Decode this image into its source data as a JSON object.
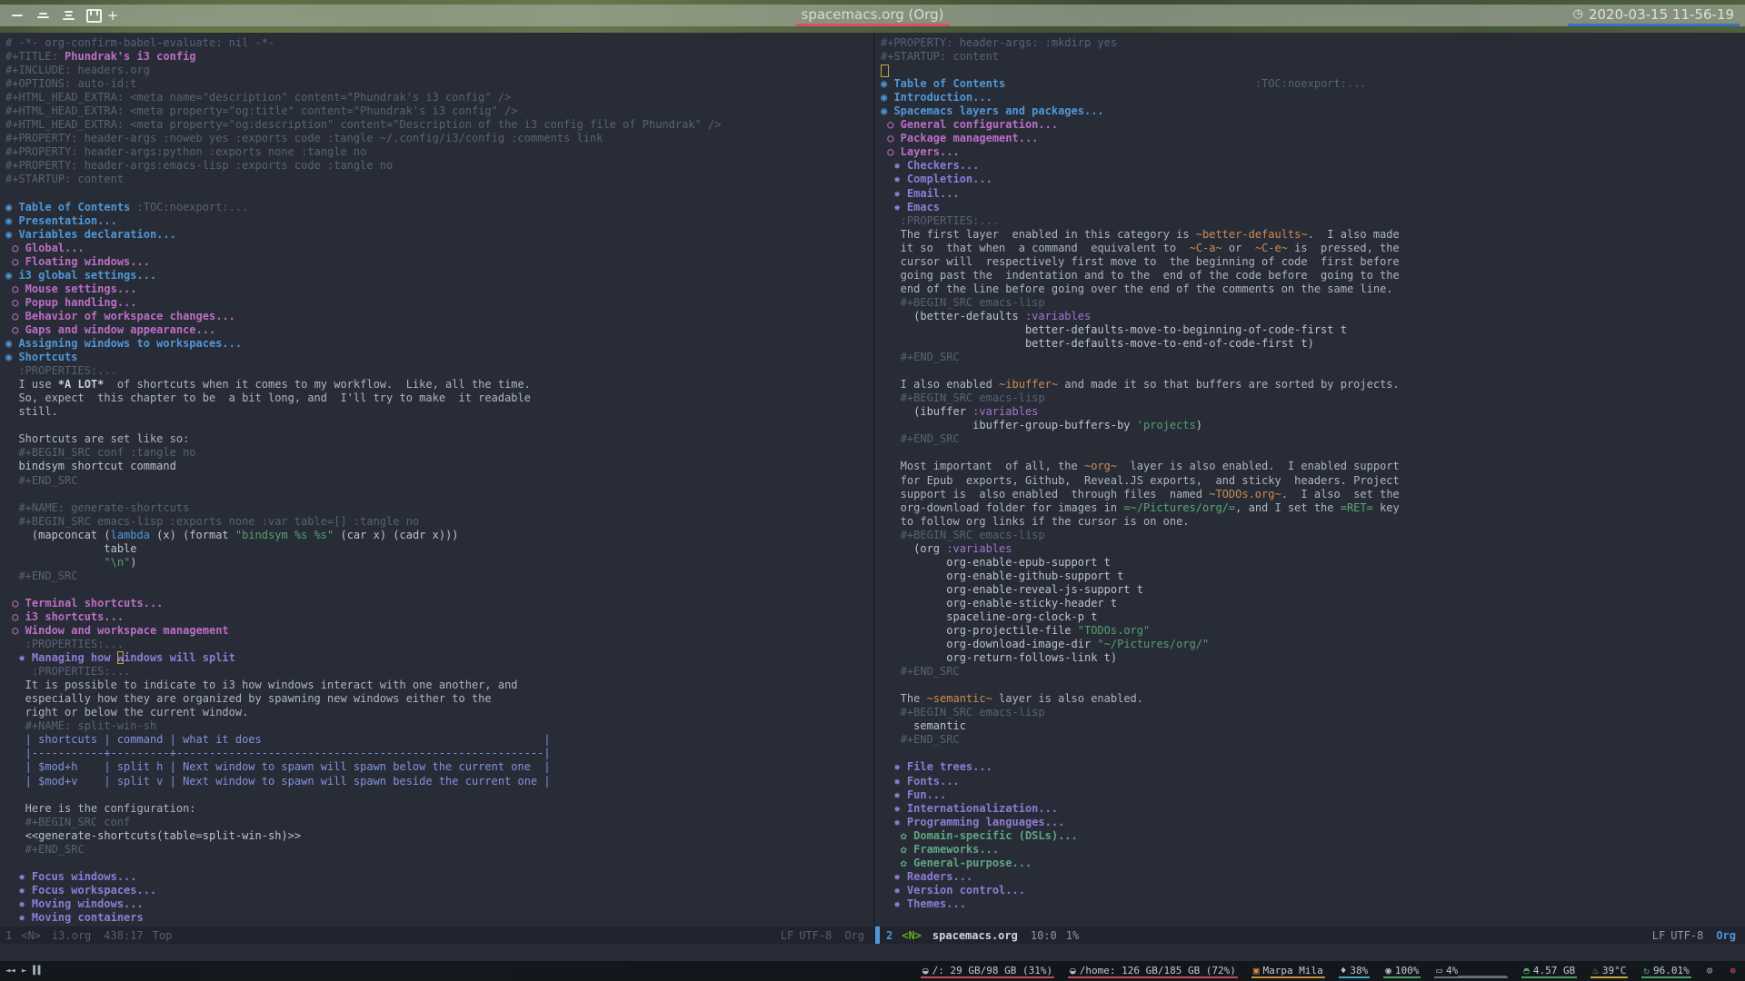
{
  "theme": {
    "accent_blue": "#4f97d7",
    "heading2_magenta": "#bc6ec5",
    "heading3_violet": "#8d7cd4",
    "heading4_green": "#5fa583",
    "org_code_orange": "#cd8b52",
    "string_green": "#55a06e",
    "cursor_yellow": "#c9a63f",
    "title_underline": "#d94f66",
    "clock_underline": "#3b72b8",
    "disk_underline": "#c14b52"
  },
  "topbar": {
    "workspaces": [
      {
        "name": "workspace-1",
        "label": "一"
      },
      {
        "name": "workspace-2",
        "label": "二"
      },
      {
        "name": "workspace-3",
        "label": "三"
      },
      {
        "name": "workspace-4",
        "label": "四"
      }
    ],
    "new_workspace_label": "+",
    "title": "spacemacs.org (Org)",
    "datetime": "2020-03-15 11-56-19",
    "clock_icon": "◷"
  },
  "left_pane": {
    "lines": [
      [
        {
          "t": "# -*- org-confirm-babel-evaluate: nil -*-",
          "c": "dim"
        }
      ],
      [
        {
          "t": "#+TITLE: ",
          "c": "dim"
        },
        {
          "t": "Phundrak's i3 config",
          "c": "title"
        }
      ],
      [
        {
          "t": "#+INCLUDE: headers.org",
          "c": "dim"
        }
      ],
      [
        {
          "t": "#+OPTIONS: auto-id:t",
          "c": "dim"
        }
      ],
      [
        {
          "t": "#+HTML_HEAD_EXTRA: <meta name=\"description\" content=\"Phundrak's i3 config\" />",
          "c": "dim"
        }
      ],
      [
        {
          "t": "#+HTML_HEAD_EXTRA: <meta property=\"og:title\" content=\"Phundrak's i3 config\" />",
          "c": "dim"
        }
      ],
      [
        {
          "t": "#+HTML_HEAD_EXTRA: <meta property=\"og:description\" content=\"Description of the i3 config file of Phundrak\" />",
          "c": "dim"
        }
      ],
      [
        {
          "t": "#+PROPERTY: header-args :noweb yes :exports code :tangle ~/.config/i3/config :comments link",
          "c": "dim"
        }
      ],
      [
        {
          "t": "#+PROPERTY: header-args:python :exports none :tangle no",
          "c": "dim"
        }
      ],
      [
        {
          "t": "#+PROPERTY: header-args:emacs-lisp :exports code :tangle no",
          "c": "dim"
        }
      ],
      [
        {
          "t": "#+STARTUP: content",
          "c": "dim"
        }
      ],
      [],
      [
        {
          "t": "◉ Table of Contents ",
          "c": "h1"
        },
        {
          "t": ":TOC:noexport:...",
          "c": "dim"
        }
      ],
      [
        {
          "t": "◉ Presentation...",
          "c": "h1"
        }
      ],
      [
        {
          "t": "◉ Variables declaration...",
          "c": "h1"
        }
      ],
      [
        {
          "t": " ○ Global...",
          "c": "h2"
        }
      ],
      [
        {
          "t": " ○ Floating windows...",
          "c": "h2"
        }
      ],
      [
        {
          "t": "◉ i3 global settings...",
          "c": "h1"
        }
      ],
      [
        {
          "t": " ○ Mouse settings...",
          "c": "h2"
        }
      ],
      [
        {
          "t": " ○ Popup handling...",
          "c": "h2"
        }
      ],
      [
        {
          "t": " ○ Behavior of workspace changes...",
          "c": "h2"
        }
      ],
      [
        {
          "t": " ○ Gaps and window appearance...",
          "c": "h2"
        }
      ],
      [
        {
          "t": "◉ Assigning windows to workspaces...",
          "c": "h1"
        }
      ],
      [
        {
          "t": "◉ Shortcuts",
          "c": "h1"
        }
      ],
      [
        {
          "t": "  :PROPERTIES:...",
          "c": "dim"
        }
      ],
      [
        {
          "t": "  I use ",
          "c": "txt"
        },
        {
          "t": "*A LOT*",
          "c": "bold"
        },
        {
          "t": "  of shortcuts when it comes to my workflow.  Like, all the time.",
          "c": "txt"
        }
      ],
      [
        {
          "t": "  So, expect  this chapter to be  a bit long, and  I'll try to make  it readable",
          "c": "txt"
        }
      ],
      [
        {
          "t": "  still.",
          "c": "txt"
        }
      ],
      [],
      [
        {
          "t": "  Shortcuts are set like so:",
          "c": "txt"
        }
      ],
      [
        {
          "t": "  #+BEGIN_SRC conf :tangle no",
          "c": "dim"
        }
      ],
      [
        {
          "t": "  bindsym shortcut command",
          "c": "src"
        }
      ],
      [
        {
          "t": "  #+END_SRC",
          "c": "dim"
        }
      ],
      [],
      [
        {
          "t": "  #+NAME: generate-shortcuts",
          "c": "dim"
        }
      ],
      [
        {
          "t": "  #+BEGIN_SRC emacs-lisp :exports none :var table=[] :tangle no",
          "c": "dim"
        }
      ],
      [
        {
          "t": "    (mapconcat (",
          "c": "src"
        },
        {
          "t": "lambda",
          "c": "kw"
        },
        {
          "t": " (x) (format ",
          "c": "src"
        },
        {
          "t": "\"bindsym %s %s\"",
          "c": "str"
        },
        {
          "t": " (car x) (cadr x)))",
          "c": "src"
        }
      ],
      [
        {
          "t": "               table",
          "c": "src"
        }
      ],
      [
        {
          "t": "               ",
          "c": "src"
        },
        {
          "t": "\"\\n\"",
          "c": "str"
        },
        {
          "t": ")",
          "c": "src"
        }
      ],
      [
        {
          "t": "  #+END_SRC",
          "c": "dim"
        }
      ],
      [],
      [
        {
          "t": " ○ Terminal shortcuts...",
          "c": "h2"
        }
      ],
      [
        {
          "t": " ○ i3 shortcuts...",
          "c": "h2"
        }
      ],
      [
        {
          "t": " ○ Window and workspace management",
          "c": "h2"
        }
      ],
      [
        {
          "t": "   :PROPERTIES:...",
          "c": "dim"
        }
      ],
      [
        {
          "t": "  ✸ Managing how ",
          "c": "h3"
        },
        {
          "t": "w",
          "c": "h3cur"
        },
        {
          "t": "indows will split",
          "c": "h3"
        }
      ],
      [
        {
          "t": "    :PROPERTIES:...",
          "c": "dim"
        }
      ],
      [
        {
          "t": "   It is possible to indicate to i3 how windows interact with one another, and",
          "c": "txt"
        }
      ],
      [
        {
          "t": "   especially how they are organized by spawning new windows either to the",
          "c": "txt"
        }
      ],
      [
        {
          "t": "   right or below the current window.",
          "c": "txt"
        }
      ],
      [
        {
          "t": "   #+NAME: split-win-sh",
          "c": "dim"
        }
      ],
      [
        {
          "t": "   | shortcuts | command | what it does                                           |",
          "c": "tbl"
        }
      ],
      [
        {
          "t": "   |-----------+---------+--------------------------------------------------------|",
          "c": "tbl"
        }
      ],
      [
        {
          "t": "   | $mod+h    | split h | Next window to spawn will spawn below the current one  |",
          "c": "tbl"
        }
      ],
      [
        {
          "t": "   | $mod+v    | split v | Next window to spawn will spawn beside the current one |",
          "c": "tbl"
        }
      ],
      [],
      [
        {
          "t": "   Here is the configuration:",
          "c": "txt"
        }
      ],
      [
        {
          "t": "   #+BEGIN_SRC conf",
          "c": "dim"
        }
      ],
      [
        {
          "t": "   <<generate-shortcuts(table=split-win-sh)>>",
          "c": "src"
        }
      ],
      [
        {
          "t": "   #+END_SRC",
          "c": "dim"
        }
      ],
      [],
      [
        {
          "t": "  ✸ Focus windows...",
          "c": "h3"
        }
      ],
      [
        {
          "t": "  ✸ Focus workspaces...",
          "c": "h3"
        }
      ],
      [
        {
          "t": "  ✸ Moving windows...",
          "c": "h3"
        }
      ],
      [
        {
          "t": "  ✸ Moving containers",
          "c": "h3"
        }
      ]
    ],
    "modeline": {
      "win": "1",
      "state": "<N>",
      "buffer": "i3.org",
      "pos": "438:17",
      "pct": "Top",
      "eol": "LF",
      "enc": "UTF-8",
      "mode": "Org"
    }
  },
  "right_pane": {
    "lines": [
      [
        {
          "t": "#+PROPERTY: header-args: :mkdirp yes",
          "c": "dim"
        }
      ],
      [
        {
          "t": "#+STARTUP: content",
          "c": "dim"
        }
      ],
      [
        {
          "t": " ",
          "c": "cur"
        }
      ],
      [
        {
          "t": "◉ Table of Contents",
          "c": "h1"
        },
        {
          "t": "                                      ",
          "c": "txt"
        },
        {
          "t": ":TOC:noexport:...",
          "c": "dim"
        }
      ],
      [
        {
          "t": "◉ Introduction...",
          "c": "h1"
        }
      ],
      [
        {
          "t": "◉ Spacemacs layers and packages...",
          "c": "h1"
        }
      ],
      [
        {
          "t": " ○ General configuration...",
          "c": "h2"
        }
      ],
      [
        {
          "t": " ○ Package management...",
          "c": "h2"
        }
      ],
      [
        {
          "t": " ○ Layers...",
          "c": "h2"
        }
      ],
      [
        {
          "t": "  ✸ Checkers...",
          "c": "h3"
        }
      ],
      [
        {
          "t": "  ✸ Completion...",
          "c": "h3"
        }
      ],
      [
        {
          "t": "  ✸ Email...",
          "c": "h3"
        }
      ],
      [
        {
          "t": "  ✸ Emacs",
          "c": "h3"
        }
      ],
      [
        {
          "t": "   :PROPERTIES:...",
          "c": "dim"
        }
      ],
      [
        {
          "t": "   The first layer  enabled in this category is ",
          "c": "txt"
        },
        {
          "t": "~better-defaults~",
          "c": "code"
        },
        {
          "t": ".  I also made",
          "c": "txt"
        }
      ],
      [
        {
          "t": "   it so  that when  a command  equivalent to  ",
          "c": "txt"
        },
        {
          "t": "~C-a~",
          "c": "code"
        },
        {
          "t": " or  ",
          "c": "txt"
        },
        {
          "t": "~C-e~",
          "c": "code"
        },
        {
          "t": " is  pressed, the",
          "c": "txt"
        }
      ],
      [
        {
          "t": "   cursor will  respectively first move to  the beginning of code  first before",
          "c": "txt"
        }
      ],
      [
        {
          "t": "   going past the  indentation and to the  end of the code before  going to the",
          "c": "txt"
        }
      ],
      [
        {
          "t": "   end of the line before going over the end of the comments on the same line.",
          "c": "txt"
        }
      ],
      [
        {
          "t": "   #+BEGIN_SRC emacs-lisp",
          "c": "dim"
        }
      ],
      [
        {
          "t": "     (better-defaults ",
          "c": "src"
        },
        {
          "t": ":variables",
          "c": "sym"
        }
      ],
      [
        {
          "t": "                      better-defaults-move-to-beginning-of-code-first t",
          "c": "src"
        }
      ],
      [
        {
          "t": "                      better-defaults-move-to-end-of-code-first t)",
          "c": "src"
        }
      ],
      [
        {
          "t": "   #+END_SRC",
          "c": "dim"
        }
      ],
      [],
      [
        {
          "t": "   I also enabled ",
          "c": "txt"
        },
        {
          "t": "~ibuffer~",
          "c": "code"
        },
        {
          "t": " and made it so that buffers are sorted by projects.",
          "c": "txt"
        }
      ],
      [
        {
          "t": "   #+BEGIN_SRC emacs-lisp",
          "c": "dim"
        }
      ],
      [
        {
          "t": "     (ibuffer ",
          "c": "src"
        },
        {
          "t": ":variables",
          "c": "sym"
        }
      ],
      [
        {
          "t": "              ibuffer-group-buffers-by ",
          "c": "src"
        },
        {
          "t": "'projects",
          "c": "str"
        },
        {
          "t": ")",
          "c": "src"
        }
      ],
      [
        {
          "t": "   #+END_SRC",
          "c": "dim"
        }
      ],
      [],
      [
        {
          "t": "   Most important  of all, the ",
          "c": "txt"
        },
        {
          "t": "~org~",
          "c": "code"
        },
        {
          "t": "  layer is also enabled.  I enabled support",
          "c": "txt"
        }
      ],
      [
        {
          "t": "   for Epub  exports, Github,  Reveal.JS exports,  and sticky  headers. Project",
          "c": "txt"
        }
      ],
      [
        {
          "t": "   support is  also enabled  through files  named ",
          "c": "txt"
        },
        {
          "t": "~TODOs.org~",
          "c": "code"
        },
        {
          "t": ".  I also  set the",
          "c": "txt"
        }
      ],
      [
        {
          "t": "   org-download folder for images in ",
          "c": "txt"
        },
        {
          "t": "=~/Pictures/org/=",
          "c": "verb"
        },
        {
          "t": ", and I set the ",
          "c": "txt"
        },
        {
          "t": "=RET=",
          "c": "verb"
        },
        {
          "t": " key",
          "c": "txt"
        }
      ],
      [
        {
          "t": "   to follow org links if the cursor is on one.",
          "c": "txt"
        }
      ],
      [
        {
          "t": "   #+BEGIN_SRC emacs-lisp",
          "c": "dim"
        }
      ],
      [
        {
          "t": "     (org ",
          "c": "src"
        },
        {
          "t": ":variables",
          "c": "sym"
        }
      ],
      [
        {
          "t": "          org-enable-epub-support t",
          "c": "src"
        }
      ],
      [
        {
          "t": "          org-enable-github-support t",
          "c": "src"
        }
      ],
      [
        {
          "t": "          org-enable-reveal-js-support t",
          "c": "src"
        }
      ],
      [
        {
          "t": "          org-enable-sticky-header t",
          "c": "src"
        }
      ],
      [
        {
          "t": "          spaceline-org-clock-p t",
          "c": "src"
        }
      ],
      [
        {
          "t": "          org-projectile-file ",
          "c": "src"
        },
        {
          "t": "\"TODOs.org\"",
          "c": "str"
        }
      ],
      [
        {
          "t": "          org-download-image-dir ",
          "c": "src"
        },
        {
          "t": "\"~/Pictures/org/\"",
          "c": "str"
        }
      ],
      [
        {
          "t": "          org-return-follows-link t)",
          "c": "src"
        }
      ],
      [
        {
          "t": "   #+END_SRC",
          "c": "dim"
        }
      ],
      [],
      [
        {
          "t": "   The ",
          "c": "txt"
        },
        {
          "t": "~semantic~",
          "c": "code"
        },
        {
          "t": " layer is also enabled.",
          "c": "txt"
        }
      ],
      [
        {
          "t": "   #+BEGIN_SRC emacs-lisp",
          "c": "dim"
        }
      ],
      [
        {
          "t": "     semantic",
          "c": "src"
        }
      ],
      [
        {
          "t": "   #+END_SRC",
          "c": "dim"
        }
      ],
      [],
      [
        {
          "t": "  ✸ File trees...",
          "c": "h3"
        }
      ],
      [
        {
          "t": "  ✸ Fonts...",
          "c": "h3"
        }
      ],
      [
        {
          "t": "  ✸ Fun...",
          "c": "h3"
        }
      ],
      [
        {
          "t": "  ✸ Internationalization...",
          "c": "h3"
        }
      ],
      [
        {
          "t": "  ✸ Programming languages...",
          "c": "h3"
        }
      ],
      [
        {
          "t": "   ✿ Domain-specific (DSLs)...",
          "c": "h4"
        }
      ],
      [
        {
          "t": "   ✿ Frameworks...",
          "c": "h4"
        }
      ],
      [
        {
          "t": "   ✿ General-purpose...",
          "c": "h4"
        }
      ],
      [
        {
          "t": "  ✸ Readers...",
          "c": "h3"
        }
      ],
      [
        {
          "t": "  ✸ Version control...",
          "c": "h3"
        }
      ],
      [
        {
          "t": "  ✸ Themes...",
          "c": "h3"
        }
      ]
    ],
    "modeline": {
      "win": "2",
      "state": "<N>",
      "buffer": "spacemacs.org",
      "pos": "10:0",
      "pct": "1%",
      "eol": "LF",
      "enc": "UTF-8",
      "mode": "Org"
    }
  },
  "tray": {
    "media": [
      {
        "name": "previous-icon",
        "glyph": "◄◄"
      },
      {
        "name": "play-icon",
        "glyph": "►"
      },
      {
        "name": "pause-icon",
        "glyph": "▌▌"
      }
    ],
    "items": [
      {
        "icon": "root-disk-icon",
        "glyph": "◒",
        "icon_color": "#b9bfc9",
        "text": "/: 29 GB/98 GB (31%)",
        "underline": "#c14b52"
      },
      {
        "icon": "home-disk-icon",
        "glyph": "◒",
        "icon_color": "#b9bfc9",
        "text": "/home: 126 GB/185 GB (72%)",
        "underline": "#c14b52"
      },
      {
        "icon": "music-icon",
        "glyph": "▣",
        "icon_color": "#d08a3e",
        "text": "Marpa Mila",
        "underline": "#c98a3d"
      },
      {
        "icon": "cpu-icon",
        "glyph": "♦",
        "icon_color": "#b9bfc9",
        "text": "38%",
        "underline": "#3fa7b8"
      },
      {
        "icon": "volume-icon",
        "glyph": "◉",
        "icon_color": "#b9bfc9",
        "text": "100%",
        "underline": "#4f9e5f"
      },
      {
        "icon": "battery-icon",
        "glyph": "▭",
        "icon_color": "#b9bfc9",
        "text": "4%________",
        "underline": "#6a7181"
      },
      {
        "icon": "memory-icon",
        "glyph": "◓",
        "icon_color": "#57a667",
        "text": "4.57 GB",
        "underline": "#4f9e5f"
      },
      {
        "icon": "temperature-icon",
        "glyph": "♨",
        "icon_color": "#c9a63f",
        "text": "39°C",
        "underline": "#c9a63f"
      },
      {
        "icon": "sync-icon",
        "glyph": "↻",
        "icon_color": "#57a667",
        "text": "96.01%",
        "underline": "#4f9e5f"
      },
      {
        "icon": "eye-icon",
        "glyph": "⊙",
        "icon_color": "#b9bfc9",
        "text": "",
        "underline": ""
      },
      {
        "icon": "power-icon",
        "glyph": "⊗",
        "icon_color": "#c14b52",
        "text": "",
        "underline": ""
      }
    ]
  }
}
